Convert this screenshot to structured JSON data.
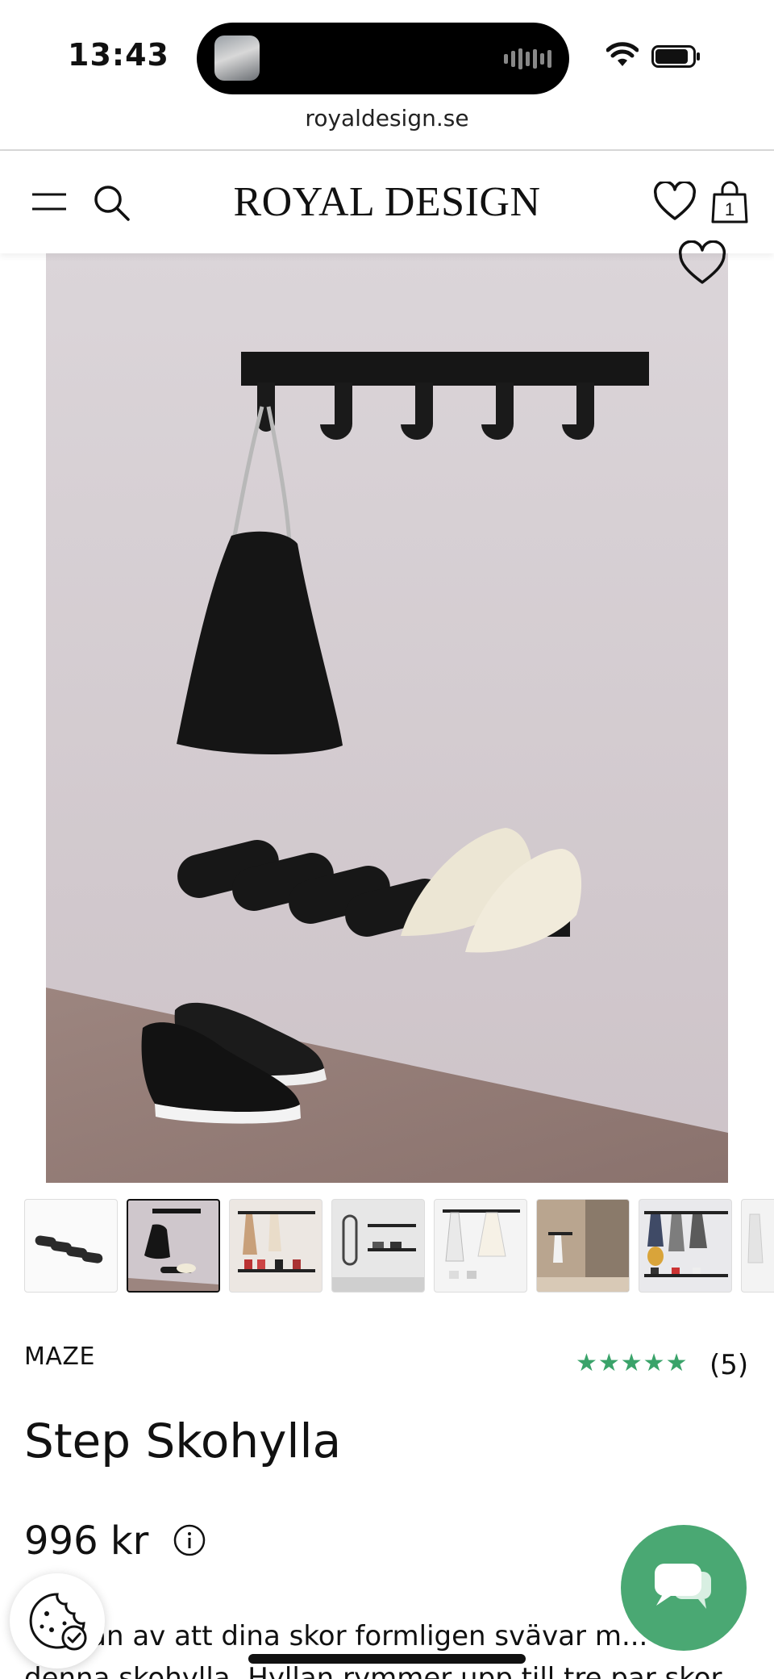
{
  "status_bar": {
    "time": "13:43",
    "url": "royaldesign.se"
  },
  "header": {
    "brand": "ROYAL DESIGN",
    "cart_count": "1",
    "icons": [
      "menu-icon",
      "search-icon",
      "heart-icon",
      "bag-icon"
    ]
  },
  "gallery": {
    "thumbnail_count": 8,
    "active_thumbnail": 2
  },
  "product": {
    "brand": "MAZE",
    "rating": {
      "stars": "★★★★★",
      "count": "(5)"
    },
    "title": "Step Skohylla",
    "price": "996 kr",
    "description_lines": [
      "...nslan av att dina skor formligen svävar m...",
      "denna skohylla. Hyllan rymmer upp till tre par skor"
    ]
  },
  "colors": {
    "accent_green": "#4aa873",
    "star_green": "#3aa36a",
    "text": "#111111"
  }
}
